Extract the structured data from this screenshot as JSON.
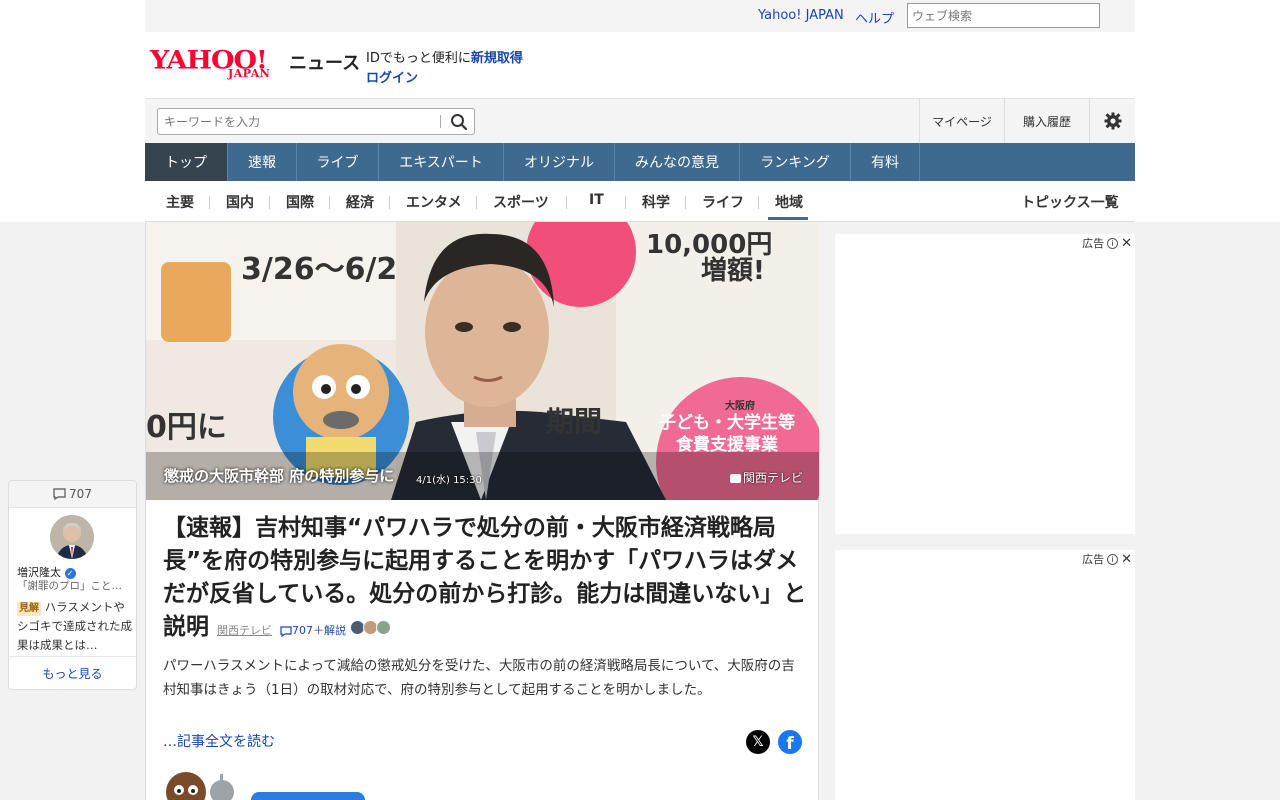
{
  "header": {
    "util_links": [
      "Yahoo! JAPAN",
      "ヘルプ"
    ],
    "web_search_placeholder": "ウェブ検索",
    "logo_main": "YAHOO!",
    "logo_sub": "JAPAN",
    "service_name": "ニュース",
    "id_prompt": "IDでもっと便利に",
    "signup_label": "新規取得",
    "login_label": "ログイン"
  },
  "search": {
    "placeholder": "キーワードを入力",
    "my_page": "マイページ",
    "purchase_history": "購入履歴"
  },
  "main_nav": [
    "トップ",
    "速報",
    "ライブ",
    "エキスパート",
    "オリジナル",
    "みんなの意見",
    "ランキング",
    "有料"
  ],
  "sub_nav": [
    "主要",
    "国内",
    "国際",
    "経済",
    "エンタメ",
    "スポーツ",
    "IT",
    "科学",
    "ライフ",
    "地域"
  ],
  "topics_all": "トピックス一覧",
  "article": {
    "hero_caption": "懲戒の大阪市幹部 府の特別参与に",
    "hero_date": "4/1(水) 15:30",
    "hero_credit": "関西テレビ",
    "headline": "【速報】吉村知事“パワハラで処分の前・大阪市経済戦略局長”を府の特別参与に起用することを明かす「パワハラはダメだが反省している。処分の前から打診。能力は間違いない」と説明",
    "source": "関西テレビ",
    "comment_link": "707＋解説",
    "summary": "パワーハラスメントによって減給の懲戒処分を受けた、大阪市の前の経済戦略局長について、大阪府の吉村知事はきょう（1日）の取材対応で、府の特別参与として起用することを明かしました。",
    "read_more": "…記事全文を読む",
    "share_x": "𝕏",
    "share_fb": "f"
  },
  "comment_widget": {
    "count": "707",
    "user_name": "増沢隆太",
    "user_role": "「謝罪のプロ」こと…",
    "badge": "見解",
    "comment_text": "ハラスメントやシゴキで達成された成果は成果とは…",
    "more": "もっと見る"
  },
  "ads": {
    "label": "広告"
  },
  "hero_texts": {
    "date_range": "3/26～6/2",
    "increase": "増額!",
    "yen_ni": "0円に",
    "period": "期間",
    "amount": "10,000円",
    "food_support": "子ども・大学生等 食費支援事業",
    "osaka": "大阪府"
  },
  "colors": {
    "nav_bg": "#3d6a8e",
    "link": "#1846b0",
    "brand_red": "#ff0033"
  }
}
